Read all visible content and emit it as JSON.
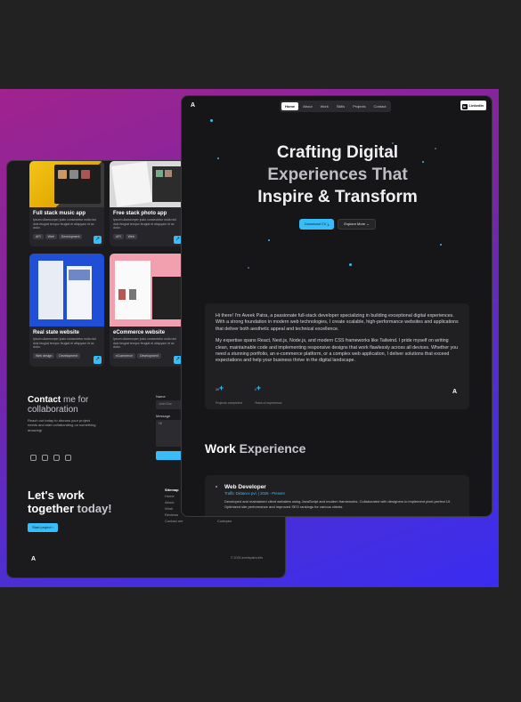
{
  "colors": {
    "accent": "#38bdf8",
    "gradient_start": "#a0238e",
    "gradient_end": "#3a2cf0",
    "window_bg": "#161618"
  },
  "back": {
    "projects": [
      {
        "title": "Full stack music app",
        "desc": "Ipsum ullamcorper justo consectetur nulla nisl duis feugiat tempor feugiat et aliquyam et ac dolor.",
        "tags": [
          "API",
          "Web",
          "Development"
        ]
      },
      {
        "title": "Free stack photo app",
        "desc": "Ipsum ullamcorper justo consectetur nulla nisl duis feugiat tempor feugiat et aliquyam et ac dolor.",
        "tags": [
          "API",
          "Web"
        ]
      },
      {
        "title": "Real state website",
        "desc": "Ipsum ullamcorper justo consectetur nulla nisl duis feugiat tempor feugiat et aliquyam et ac dolor.",
        "tags": [
          "Web design",
          "Development"
        ]
      },
      {
        "title": "eCommerce website",
        "desc": "Ipsum ullamcorper justo consectetur nulla nisl duis feugiat tempor feugiat et aliquyam et ac dolor.",
        "tags": [
          "eCommerce",
          "Development"
        ]
      }
    ],
    "contact": {
      "title_a": "Contact",
      "title_b": "me for collaboration",
      "desc": "Reach out today to discuss your project needs and start collaborating on something amazing!",
      "name_label": "Name",
      "name_value": "John Doe",
      "message_label": "Message",
      "message_value": "Hi!"
    },
    "cta": {
      "line1": "Let's work",
      "line2a": "together",
      "line2b": "today!",
      "button": "Start project"
    },
    "sitemap": {
      "title": "Sitemap",
      "links": [
        "Home",
        "About",
        "Work",
        "Reviews",
        "Contact me"
      ],
      "extra": "Codepen"
    },
    "logo": "A",
    "copyright": "© 2025 aveekpatra.info"
  },
  "front": {
    "logo": "A",
    "nav": [
      "Home",
      "About",
      "Work",
      "Skills",
      "Projects",
      "Contact"
    ],
    "nav_active": "Home",
    "linkedin": "LinkedIn",
    "hero": {
      "l1": "Crafting Digital",
      "l2": "Experiences That",
      "l3": "Inspire & Transform"
    },
    "btn_primary": "Download CV",
    "btn_secondary": "Explore More",
    "about_p1": "Hi there! I'm Aveek Patra, a passionate full-stack developer specializing in building exceptional digital experiences. With a strong foundation in modern web technologies, I create scalable, high-performance websites and applications that deliver both aesthetic appeal and technical excellence.",
    "about_p2": "My expertise spans React, Next.js, Node.js, and modern CSS frameworks like Tailwind. I pride myself on writing clean, maintainable code and implementing responsive designs that work flawlessly across all devices. Whether you need a stunning portfolio, an e-commerce platform, or a complex web application, I deliver solutions that exceed expectations and help your business thrive in the digital landscape.",
    "stats": [
      {
        "num": "20",
        "suffix": "+",
        "label": "Projects completed"
      },
      {
        "num": "3",
        "suffix": "+",
        "label": "Years of experience"
      }
    ],
    "work_title_a": "Work",
    "work_title_b": "Experience",
    "job": {
      "title": "Web Developer",
      "company": "Traffic Distance pvt. | 2025 - Present",
      "desc": "Developed and maintained client websites using JavaScript and modern frameworks. Collaborated with designers to implement pixel-perfect UI. Optimized site performance and improved SEO rankings for various clients."
    }
  }
}
